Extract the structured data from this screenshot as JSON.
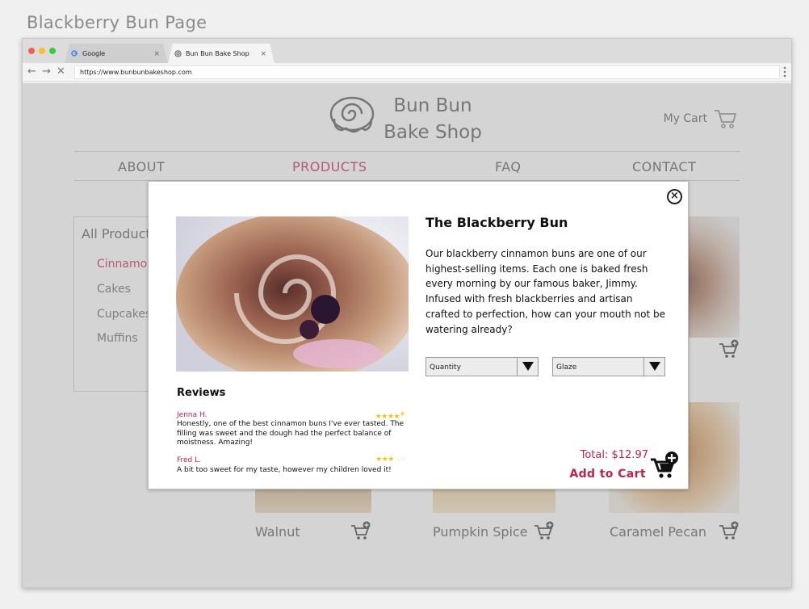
{
  "page_title": "Blackberry Bun Page",
  "browser": {
    "tabs": [
      {
        "label": "Google",
        "favicon": "google-icon"
      },
      {
        "label": "Bun Bun Bake Shop",
        "favicon": "bun-icon"
      }
    ],
    "tab_close": "×",
    "url": "https://www.bunbunbakeshop.com"
  },
  "site": {
    "brand_line1": "Bun Bun",
    "brand_line2": "Bake Shop",
    "cart_label": "My Cart",
    "nav": [
      "ABOUT",
      "PRODUCTS",
      "FAQ",
      "CONTACT"
    ],
    "active_nav": "PRODUCTS",
    "accent_color": "#c0224a"
  },
  "sidebar": {
    "heading": "All Products",
    "items": [
      "Cinnamon",
      "Cakes",
      "Cupcakes",
      "Muffins"
    ]
  },
  "products": [
    "Walnut",
    "Pumpkin Spice",
    "Caramel Pecan"
  ],
  "modal": {
    "title": "The Blackberry Bun",
    "description": "Our blackberry cinnamon buns are one of our highest-selling items. Each one is baked fresh every morning by our famous baker, Jimmy. Infused with fresh blackberries and artisan crafted to perfection, how can your mouth not be watering already?",
    "quantity_label": "Quantity",
    "glaze_label": "Glaze",
    "reviews_heading": "Reviews",
    "reviews": [
      {
        "author": "Jenna H.",
        "rating": 4.5,
        "text": "Honestly, one of the best cinnamon buns I've ever tasted. The filling was sweet and the dough had the perfect balance of moistness. Amazing!"
      },
      {
        "author": "Fred L.",
        "rating": 3,
        "text": "A bit too sweet for my taste, however my children loved it!"
      }
    ],
    "total": "Total: $12.97",
    "add_to_cart": "Add to Cart",
    "close_symbol": "×"
  }
}
